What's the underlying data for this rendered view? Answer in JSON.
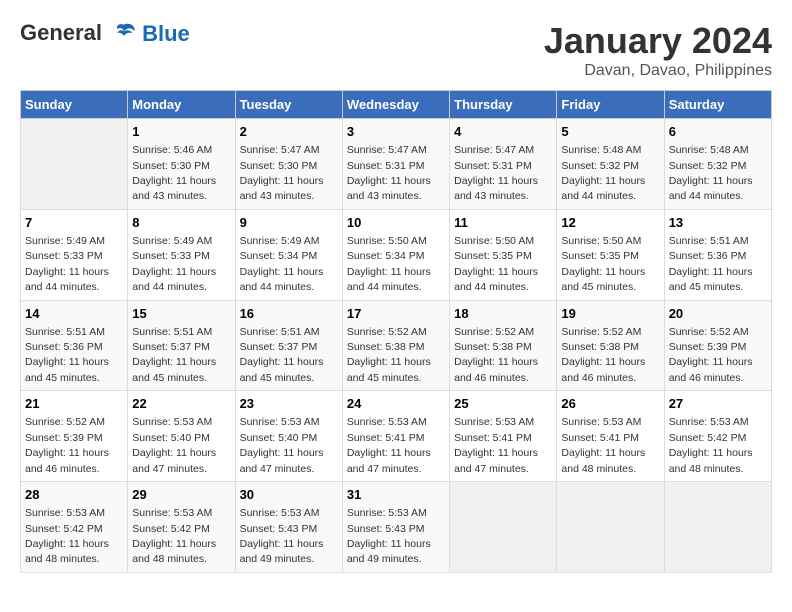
{
  "logo": {
    "line1": "General",
    "line2": "Blue"
  },
  "title": "January 2024",
  "subtitle": "Davan, Davao, Philippines",
  "days_of_week": [
    "Sunday",
    "Monday",
    "Tuesday",
    "Wednesday",
    "Thursday",
    "Friday",
    "Saturday"
  ],
  "weeks": [
    [
      {
        "day": null
      },
      {
        "day": 1,
        "sunrise": "5:46 AM",
        "sunset": "5:30 PM",
        "daylight": "11 hours and 43 minutes."
      },
      {
        "day": 2,
        "sunrise": "5:47 AM",
        "sunset": "5:30 PM",
        "daylight": "11 hours and 43 minutes."
      },
      {
        "day": 3,
        "sunrise": "5:47 AM",
        "sunset": "5:31 PM",
        "daylight": "11 hours and 43 minutes."
      },
      {
        "day": 4,
        "sunrise": "5:47 AM",
        "sunset": "5:31 PM",
        "daylight": "11 hours and 43 minutes."
      },
      {
        "day": 5,
        "sunrise": "5:48 AM",
        "sunset": "5:32 PM",
        "daylight": "11 hours and 44 minutes."
      },
      {
        "day": 6,
        "sunrise": "5:48 AM",
        "sunset": "5:32 PM",
        "daylight": "11 hours and 44 minutes."
      }
    ],
    [
      {
        "day": 7,
        "sunrise": "5:49 AM",
        "sunset": "5:33 PM",
        "daylight": "11 hours and 44 minutes."
      },
      {
        "day": 8,
        "sunrise": "5:49 AM",
        "sunset": "5:33 PM",
        "daylight": "11 hours and 44 minutes."
      },
      {
        "day": 9,
        "sunrise": "5:49 AM",
        "sunset": "5:34 PM",
        "daylight": "11 hours and 44 minutes."
      },
      {
        "day": 10,
        "sunrise": "5:50 AM",
        "sunset": "5:34 PM",
        "daylight": "11 hours and 44 minutes."
      },
      {
        "day": 11,
        "sunrise": "5:50 AM",
        "sunset": "5:35 PM",
        "daylight": "11 hours and 44 minutes."
      },
      {
        "day": 12,
        "sunrise": "5:50 AM",
        "sunset": "5:35 PM",
        "daylight": "11 hours and 45 minutes."
      },
      {
        "day": 13,
        "sunrise": "5:51 AM",
        "sunset": "5:36 PM",
        "daylight": "11 hours and 45 minutes."
      }
    ],
    [
      {
        "day": 14,
        "sunrise": "5:51 AM",
        "sunset": "5:36 PM",
        "daylight": "11 hours and 45 minutes."
      },
      {
        "day": 15,
        "sunrise": "5:51 AM",
        "sunset": "5:37 PM",
        "daylight": "11 hours and 45 minutes."
      },
      {
        "day": 16,
        "sunrise": "5:51 AM",
        "sunset": "5:37 PM",
        "daylight": "11 hours and 45 minutes."
      },
      {
        "day": 17,
        "sunrise": "5:52 AM",
        "sunset": "5:38 PM",
        "daylight": "11 hours and 45 minutes."
      },
      {
        "day": 18,
        "sunrise": "5:52 AM",
        "sunset": "5:38 PM",
        "daylight": "11 hours and 46 minutes."
      },
      {
        "day": 19,
        "sunrise": "5:52 AM",
        "sunset": "5:38 PM",
        "daylight": "11 hours and 46 minutes."
      },
      {
        "day": 20,
        "sunrise": "5:52 AM",
        "sunset": "5:39 PM",
        "daylight": "11 hours and 46 minutes."
      }
    ],
    [
      {
        "day": 21,
        "sunrise": "5:52 AM",
        "sunset": "5:39 PM",
        "daylight": "11 hours and 46 minutes."
      },
      {
        "day": 22,
        "sunrise": "5:53 AM",
        "sunset": "5:40 PM",
        "daylight": "11 hours and 47 minutes."
      },
      {
        "day": 23,
        "sunrise": "5:53 AM",
        "sunset": "5:40 PM",
        "daylight": "11 hours and 47 minutes."
      },
      {
        "day": 24,
        "sunrise": "5:53 AM",
        "sunset": "5:41 PM",
        "daylight": "11 hours and 47 minutes."
      },
      {
        "day": 25,
        "sunrise": "5:53 AM",
        "sunset": "5:41 PM",
        "daylight": "11 hours and 47 minutes."
      },
      {
        "day": 26,
        "sunrise": "5:53 AM",
        "sunset": "5:41 PM",
        "daylight": "11 hours and 48 minutes."
      },
      {
        "day": 27,
        "sunrise": "5:53 AM",
        "sunset": "5:42 PM",
        "daylight": "11 hours and 48 minutes."
      }
    ],
    [
      {
        "day": 28,
        "sunrise": "5:53 AM",
        "sunset": "5:42 PM",
        "daylight": "11 hours and 48 minutes."
      },
      {
        "day": 29,
        "sunrise": "5:53 AM",
        "sunset": "5:42 PM",
        "daylight": "11 hours and 48 minutes."
      },
      {
        "day": 30,
        "sunrise": "5:53 AM",
        "sunset": "5:43 PM",
        "daylight": "11 hours and 49 minutes."
      },
      {
        "day": 31,
        "sunrise": "5:53 AM",
        "sunset": "5:43 PM",
        "daylight": "11 hours and 49 minutes."
      },
      {
        "day": null
      },
      {
        "day": null
      },
      {
        "day": null
      }
    ]
  ],
  "labels": {
    "sunrise": "Sunrise:",
    "sunset": "Sunset:",
    "daylight": "Daylight:"
  }
}
